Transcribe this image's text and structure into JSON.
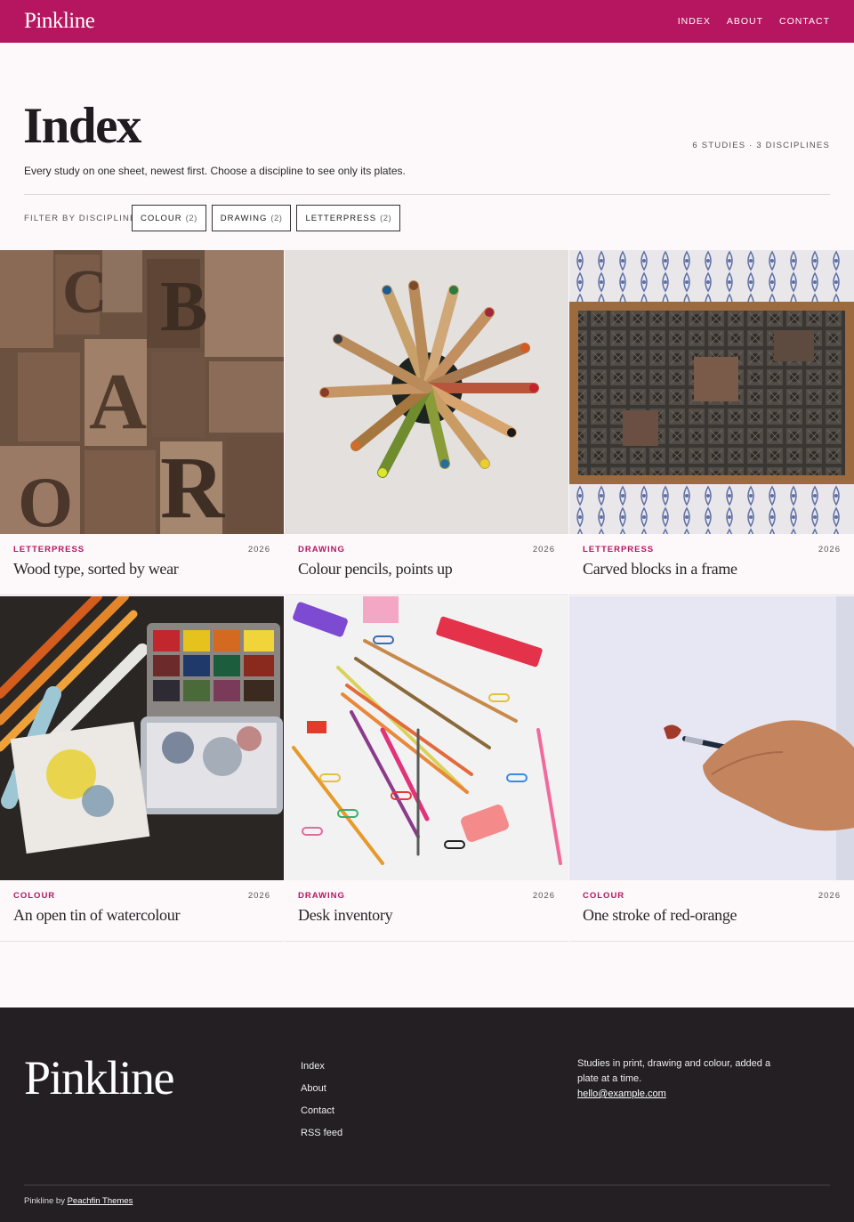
{
  "header": {
    "brand": "Pinkline",
    "nav": [
      "INDEX",
      "ABOUT",
      "CONTACT"
    ]
  },
  "intro": {
    "title": "Index",
    "counts": "6 STUDIES · 3 DISCIPLINES",
    "description": "Every study on one sheet, newest first. Choose a discipline to see only its plates.",
    "filter_label": "FILTER BY DISCIPLINE",
    "filters": [
      {
        "label": "COLOUR",
        "count": "(2)"
      },
      {
        "label": "DRAWING",
        "count": "(2)"
      },
      {
        "label": "LETTERPRESS",
        "count": "(2)"
      }
    ]
  },
  "cards": [
    {
      "category": "LETTERPRESS",
      "year": "2026",
      "title": "Wood type, sorted by wear",
      "image": "wood-type-photo"
    },
    {
      "category": "DRAWING",
      "year": "2026",
      "title": "Colour pencils, points up",
      "image": "pencils-photo"
    },
    {
      "category": "LETTERPRESS",
      "year": "2026",
      "title": "Carved blocks in a frame",
      "image": "carved-blocks-photo"
    },
    {
      "category": "COLOUR",
      "year": "2026",
      "title": "An open tin of watercolour",
      "image": "watercolour-tin-photo"
    },
    {
      "category": "DRAWING",
      "year": "2026",
      "title": "Desk inventory",
      "image": "desk-inventory-photo"
    },
    {
      "category": "COLOUR",
      "year": "2026",
      "title": "One stroke of red-orange",
      "image": "brush-stroke-photo"
    }
  ],
  "footer": {
    "brand": "Pinkline",
    "links": [
      "Index",
      "About",
      "Contact",
      "RSS feed"
    ],
    "about": "Studies in print, drawing and colour, added a plate at a time.",
    "email": "hello@example.com",
    "credit_prefix": "Pinkline by",
    "credit_link": "Peachfin Themes"
  },
  "colors": {
    "accent": "#b5165f",
    "footer_bg": "#231f22",
    "page_bg": "#fdf8fa"
  }
}
